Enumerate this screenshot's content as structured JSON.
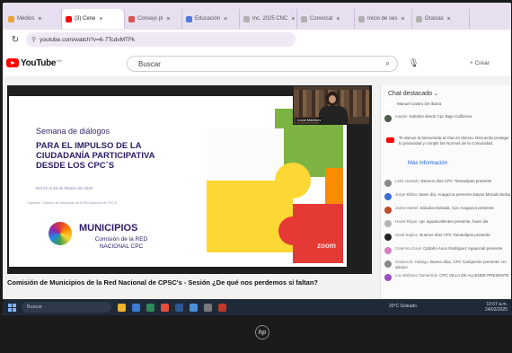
{
  "browser": {
    "tabs": [
      {
        "label": "Medios",
        "color": "#e8a33a",
        "active": false
      },
      {
        "label": "(3) Cene",
        "color": "#ff0000",
        "active": true
      },
      {
        "label": "Consejo pl",
        "color": "#d9534f",
        "active": false
      },
      {
        "label": "Educación",
        "color": "#4a7bd9",
        "active": false
      },
      {
        "label": "Inc. 2025 CNC",
        "color": "#b0b0b0",
        "active": false
      },
      {
        "label": "Convocat",
        "color": "#b0b0b0",
        "active": false
      },
      {
        "label": "Inicio de ses",
        "color": "#b0b0b0",
        "active": false
      },
      {
        "label": "Gracias",
        "color": "#b0b0b0",
        "active": false
      }
    ],
    "url": "youtube.com/watch?v=6-7TcdvMTFk"
  },
  "youtube": {
    "logo_word": "YouTube",
    "logo_sup": "MX",
    "search_placeholder": "Buscar",
    "create_label": "+ Crear"
  },
  "video": {
    "slide": {
      "line1": "Semana de diálogos",
      "line2": "PARA EL IMPULSO DE LA CIUDADANÍA PARTICIPATIVA DESDE LOS CPC´S",
      "dates": "Del 24 al 28 de febrero de 2025",
      "organizer": "Organiza: Comisión de Municipios de la Red Nacional de CPC´S",
      "brand": "MUNICIPIOS",
      "brand_sub": "Comisión de la RED NACIONAL CPC"
    },
    "webcam_name": "Lucía Martínez",
    "watermark": "zoom",
    "title": "Comisión de Municipios de la Red Nacional de CPSC's - Sesión ¿De qué nos perdemos si faltan?"
  },
  "chat": {
    "header": "Chat destacado",
    "pinned": [
      {
        "author": "",
        "text": "Manuel Castro De Ibarra",
        "color": "#ffffff"
      },
      {
        "author": "maybe",
        "text": "Saludos desde Cpc Baja California",
        "color": "#4e5a4e"
      }
    ],
    "notice": "Te damos la bienvenida al chat en directo. Recuerda proteger tu privacidad y cumplir las Normas de la Comunidad.",
    "more_info": "Más información",
    "messages": [
      {
        "author": "Leila Hurtado",
        "text": "Buenos días CPC Tamaulipas presente",
        "color": "#8a8a8a"
      },
      {
        "author": "Jorge Bilbao",
        "text": "Buen día. Aragazca presente Dayan Morado Bolsa",
        "color": "#3b6fd0"
      },
      {
        "author": "Jaime Mariel",
        "text": "Saludos Estrada. Cpc Aragazca presente",
        "color": "#c24b2a"
      },
      {
        "author": "Hazel Rique",
        "text": "cpc aguascalientes presente, buen dia",
        "color": "#b4b4b4"
      },
      {
        "author": "Gisel Espino",
        "text": "Buenos días CPC Tamaulipas presente",
        "color": "#222222"
      },
      {
        "author": "Celerina Good",
        "text": "Cpbaho Anox Rodriguez Aguascali presente",
        "color": "#d97fc4"
      },
      {
        "author": "Xoanxx B. Hidalgo",
        "text": "Bueno días, CPC Campeche presente. Un abrazo",
        "color": "#8a8a8a"
      },
      {
        "author": "Loo Bolzano Tamarindo",
        "text": "CPC VILLA DE ALLENDE PRESENTE",
        "color": "#9b4fc4"
      }
    ]
  },
  "taskbar": {
    "search_label": "Buscar",
    "weather": "20°C Soleado",
    "time": "10:07 a.m.",
    "date": "24/02/2025"
  },
  "bezel": {
    "brand": "hp"
  }
}
